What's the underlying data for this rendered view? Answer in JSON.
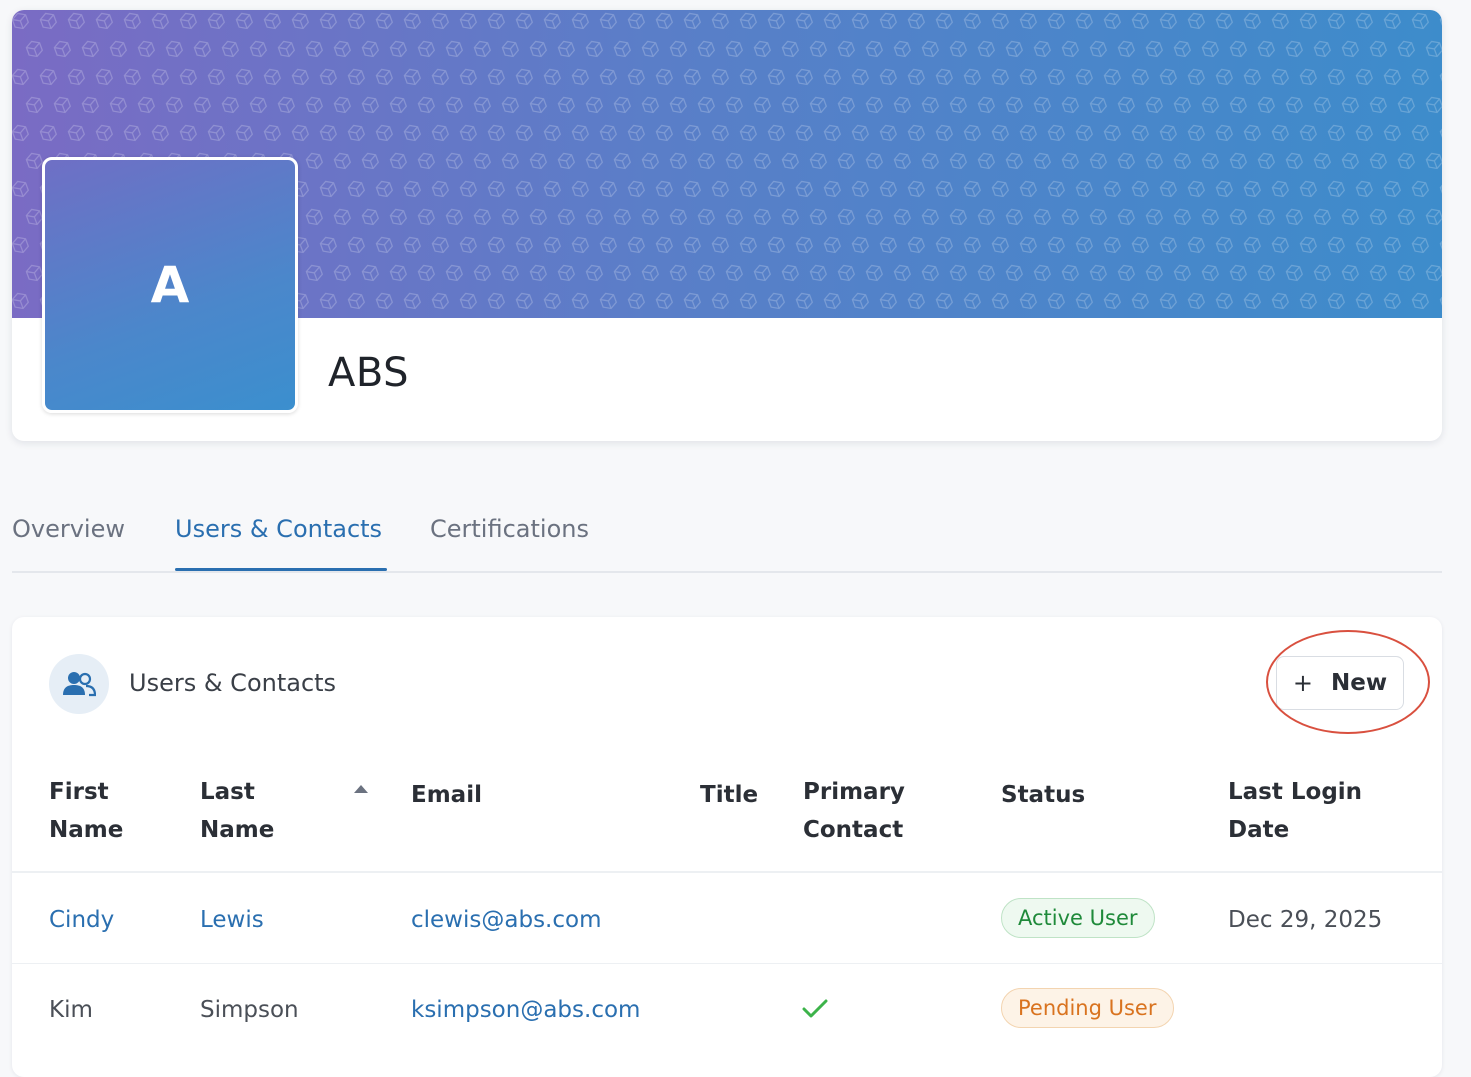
{
  "profile": {
    "avatar_letter": "A",
    "company_name": "ABS"
  },
  "tabs": [
    {
      "label": "Overview",
      "active": false
    },
    {
      "label": "Users & Contacts",
      "active": true
    },
    {
      "label": "Certifications",
      "active": false
    }
  ],
  "users_section": {
    "title": "Users & Contacts",
    "icon": "users-icon",
    "new_button": {
      "icon": "plus-icon",
      "label": "New"
    }
  },
  "table": {
    "headers": {
      "first_name": [
        "First",
        "Name"
      ],
      "last_name": [
        "Last",
        "Name"
      ],
      "email": "Email",
      "title": "Title",
      "primary_contact": [
        "Primary",
        "Contact"
      ],
      "status": "Status",
      "last_login": [
        "Last Login",
        "Date"
      ]
    },
    "sort_icon": "sort-ascending-icon",
    "rows": [
      {
        "first_name": "Cindy",
        "last_name": "Lewis",
        "email": "clewis@abs.com",
        "title": "",
        "primary_contact": false,
        "status": "Active User",
        "last_login": "Dec 29, 2025"
      },
      {
        "first_name": "Kim",
        "last_name": "Simpson",
        "email": "ksimpson@abs.com",
        "title": "",
        "primary_contact": true,
        "status": "Pending User",
        "last_login": ""
      }
    ]
  },
  "colors": {
    "accent": "#2a6fb0",
    "active_badge": "#1f8a3a",
    "pending_badge": "#d9731f",
    "check": "#3cb34a",
    "highlight_ring": "#d9503f"
  }
}
